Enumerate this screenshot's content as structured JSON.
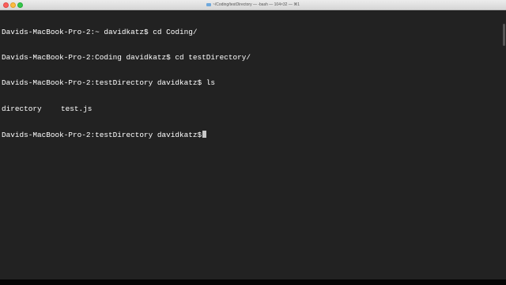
{
  "window": {
    "title": "~/Coding/testDirectory — -bash — 104×32 — ⌘1"
  },
  "terminal": {
    "lines": [
      {
        "prompt": "Davids-MacBook-Pro-2:~ davidkatz$",
        "command": " cd Coding/"
      },
      {
        "prompt": "Davids-MacBook-Pro-2:Coding davidkatz$",
        "command": " cd testDirectory/"
      },
      {
        "prompt": "Davids-MacBook-Pro-2:testDirectory davidkatz$",
        "command": " ls"
      }
    ],
    "ls_output": [
      "directory",
      "test.js"
    ],
    "current_prompt": "Davids-MacBook-Pro-2:testDirectory davidkatz$"
  },
  "colors": {
    "background": "#222222",
    "foreground": "#ffffff",
    "close": "#fc605c",
    "minimize": "#fdbc40",
    "maximize": "#34c84a"
  }
}
